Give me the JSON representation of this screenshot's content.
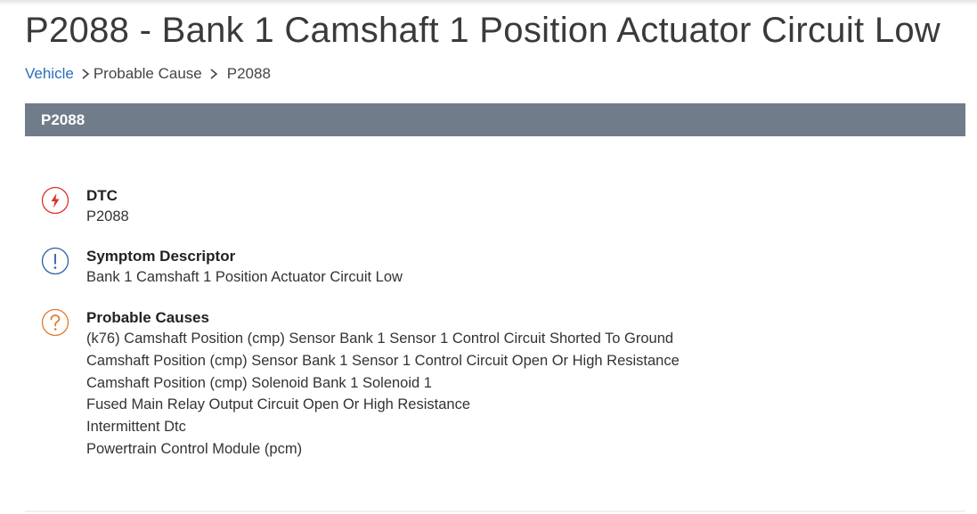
{
  "header": {
    "title": "P2088 - Bank 1 Camshaft 1 Position Actuator Circuit Low"
  },
  "breadcrumb": {
    "items": [
      "Vehicle",
      "Probable Cause",
      "P2088"
    ]
  },
  "section": {
    "title": "P2088"
  },
  "details": {
    "dtc": {
      "label": "DTC",
      "value": "P2088",
      "icon": "lightning-icon",
      "color": "#d9322f"
    },
    "symptom": {
      "label": "Symptom Descriptor",
      "value": "Bank 1 Camshaft 1 Position Actuator Circuit Low",
      "icon": "exclamation-icon",
      "color": "#2a5fa8"
    },
    "causes": {
      "label": "Probable Causes",
      "icon": "question-icon",
      "color": "#e07a2c",
      "items": [
        "(k76) Camshaft Position (cmp) Sensor Bank 1 Sensor 1 Control Circuit Shorted To Ground",
        "Camshaft Position (cmp) Sensor Bank 1 Sensor 1 Control Circuit Open Or High Resistance",
        "Camshaft Position (cmp) Solenoid Bank 1 Solenoid 1",
        "Fused Main Relay Output Circuit Open Or High Resistance",
        "Intermittent Dtc",
        "Powertrain Control Module (pcm)"
      ]
    }
  },
  "colors": {
    "section_bar": "#707c8a",
    "link": "#2a6ebb"
  }
}
